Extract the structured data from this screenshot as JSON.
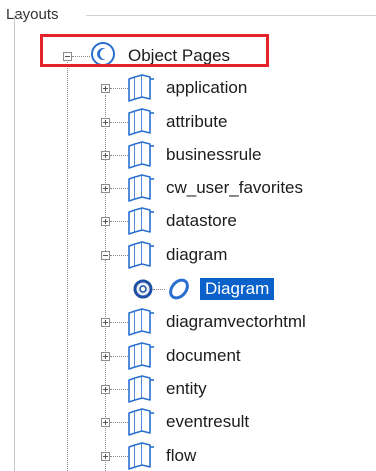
{
  "panel": {
    "title": "Layouts"
  },
  "tree": {
    "root": {
      "label": "Object Pages",
      "icon": "object-pages-icon",
      "expanded": true
    },
    "items": [
      {
        "label": "application",
        "icon": "folder-icon",
        "expanded": false
      },
      {
        "label": "attribute",
        "icon": "folder-icon",
        "expanded": false
      },
      {
        "label": "businessrule",
        "icon": "folder-icon",
        "expanded": false
      },
      {
        "label": "cw_user_favorites",
        "icon": "folder-icon",
        "expanded": false
      },
      {
        "label": "datastore",
        "icon": "folder-icon",
        "expanded": false
      },
      {
        "label": "diagram",
        "icon": "folder-icon",
        "expanded": true,
        "children": [
          {
            "label": "Diagram",
            "icon": "diagram-icon",
            "selected": true
          }
        ]
      },
      {
        "label": "diagramvectorhtml",
        "icon": "folder-icon",
        "expanded": false
      },
      {
        "label": "document",
        "icon": "folder-icon",
        "expanded": false
      },
      {
        "label": "entity",
        "icon": "folder-icon",
        "expanded": false
      },
      {
        "label": "eventresult",
        "icon": "folder-icon",
        "expanded": false
      },
      {
        "label": "flow",
        "icon": "folder-icon",
        "expanded": false
      }
    ]
  },
  "colors": {
    "highlight_border": "#e6232a",
    "selection": "#0a61c9",
    "icon_blue": "#2a6fd0"
  }
}
